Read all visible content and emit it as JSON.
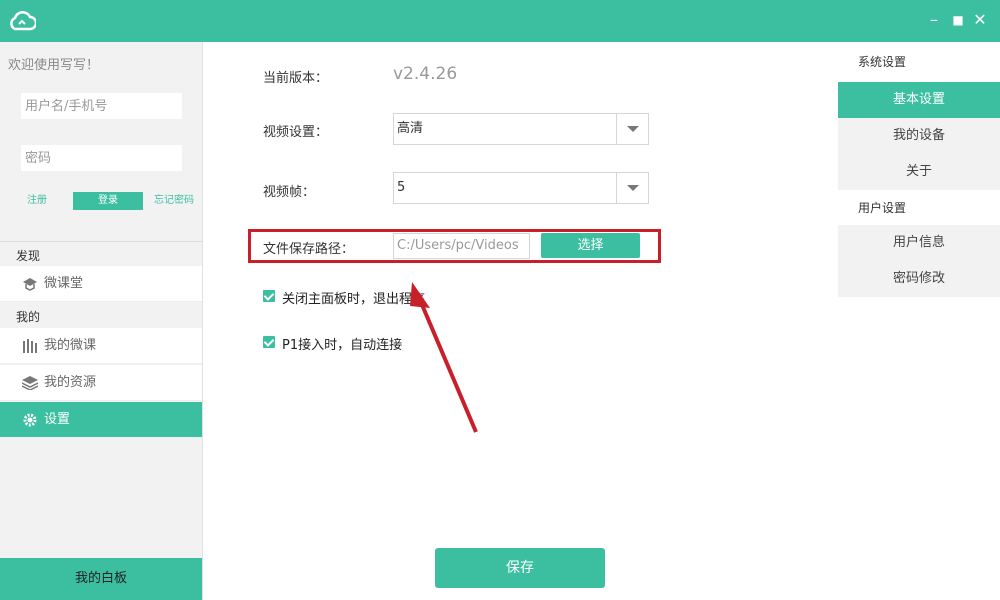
{
  "titlebar": {
    "minimize": "–",
    "maximize": "■",
    "close": "✕"
  },
  "left": {
    "welcome": "欢迎使用写写！",
    "username_placeholder": "用户名/手机号",
    "password_placeholder": "密码",
    "register": "注册",
    "login": "登录",
    "forgot": "忘记密码",
    "section_discover": "发现",
    "item_course": "微课堂",
    "section_mine": "我的",
    "item_mycourses": "我的微课",
    "item_resources": "我的资源",
    "item_settings": "设置",
    "whiteboard": "我的白板"
  },
  "right": {
    "system_header": "系统设置",
    "basic": "基本设置",
    "devices": "我的设备",
    "about": "关于",
    "user_header": "用户设置",
    "userinfo": "用户信息",
    "password": "密码修改"
  },
  "main": {
    "version_label": "当前版本：",
    "version_value": "v2.4.26",
    "video_label": "视频设置：",
    "video_value": "高清",
    "fps_label": "视频帧：",
    "fps_value": "5",
    "path_label": "文件保存路径：",
    "path_value": "C:/Users/pc/Videos",
    "choose": "选择",
    "check1": "关闭主面板时，退出程序",
    "check2": "P1接入时，自动连接",
    "save": "保存"
  },
  "colors": {
    "accent": "#3bbfa0",
    "highlight": "#c8202a"
  }
}
